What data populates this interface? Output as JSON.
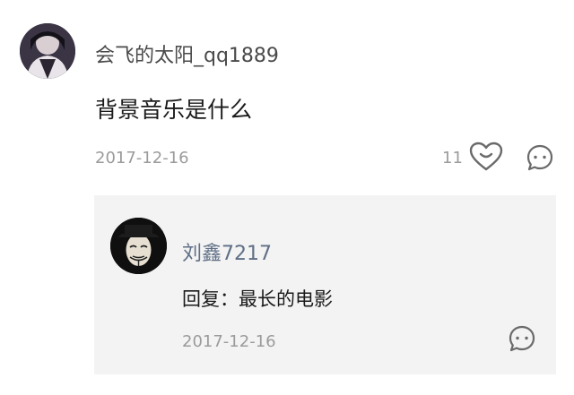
{
  "comment": {
    "username": "会飞的太阳_qq1889",
    "text": "背景音乐是什么",
    "date": "2017-12-16",
    "like_count": "11",
    "icons": {
      "avatar": "avatar",
      "like": "heart-smile-icon",
      "reply": "comment-bubble-icon"
    }
  },
  "reply": {
    "username": "刘鑫7217",
    "text": "回复：最长的电影",
    "date": "2017-12-16",
    "icons": {
      "avatar": "mask-avatar",
      "reply": "comment-bubble-icon"
    }
  },
  "colors": {
    "reply_username": "#5f6f86",
    "reply_background": "#f3f3f3",
    "meta_gray": "#9b9b9b"
  }
}
